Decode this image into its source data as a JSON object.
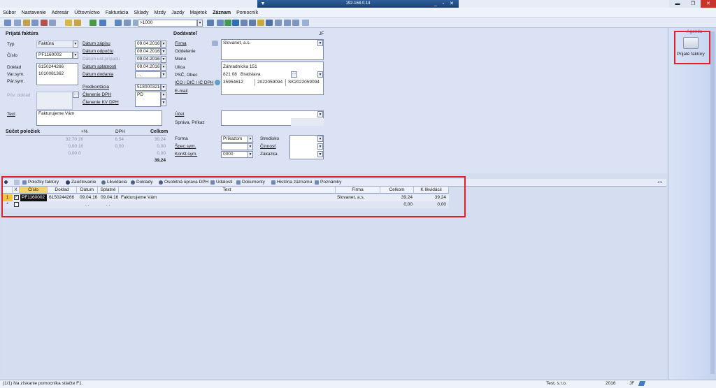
{
  "window": {
    "title_host": "192.168.0.14"
  },
  "menu": [
    "Súbor",
    "Nastavenie",
    "Adresár",
    "Účtovníctvo",
    "Fakturácia",
    "Sklady",
    "Mzdy",
    "Jazdy",
    "Majetok",
    "Záznam",
    "Pomocník"
  ],
  "toolbar": {
    "filter_value": ">1000"
  },
  "invoice": {
    "section_title": "Prijatá faktúra",
    "typ_label": "Typ",
    "typ_value": "Faktúra",
    "cislo_label": "Číslo",
    "cislo_value": "PF1160002",
    "doklad_label": "Doklad",
    "doklad_value": "6150244266",
    "varsym_label": "Var.sym.",
    "varsym_value": "1010081362",
    "parsym_label": "Pár.sym.",
    "povdoklad_label": "Pôv. doklad",
    "text_label": "Text",
    "text_value": "Fakturujeme Vám",
    "datum_zapisu_label": "Dátum zápisu",
    "datum_zapisu": "09.04.2016",
    "datum_odpoctu_label": "Dátum odpočtu",
    "datum_odpoctu": "09.04.2016",
    "datum_ust_label": "Dátum ust.prípadu",
    "datum_ust": "09.04.2016",
    "datum_splatnosti_label": "Dátum splatnosti",
    "datum_splatnosti": "09.04.2016",
    "datum_dodania_label": "Dátum dodania",
    "datum_dodania": ". .",
    "predkontacia_label": "Predkontácia",
    "predkontacia_value": "518000321000",
    "clenenie_dph_label": "Členenie DPH",
    "clenenie_dph_value": "PD",
    "clenenie_kv_label": "Členenie KV DPH"
  },
  "summary": {
    "title": "Súčet položiek",
    "col_pct": "+%",
    "col_dph": "DPH",
    "col_celkom": "Celkom",
    "rows": [
      {
        "base": "32,70",
        "pct": "20",
        "dph": "6,54",
        "total": "39,24"
      },
      {
        "base": "0,00",
        "pct": "10",
        "dph": "0,00",
        "total": "0,00"
      },
      {
        "base": "0,00",
        "pct": "0",
        "dph": "",
        "total": "0,00"
      }
    ],
    "grand_total": "39,24"
  },
  "supplier": {
    "section_title": "Dodávateľ",
    "initials": "JF",
    "firma_label": "Firma",
    "firma_value": "Slovanet, a.s.",
    "oddelenie_label": "Oddelenie",
    "meno_label": "Meno",
    "ulica_label": "Ulica",
    "ulica_value": "Záhradnícka 151",
    "psc_label": "PSČ, Obec",
    "psc_value": "821 08",
    "obec_value": "Bratislava",
    "ico_label": "IČO / DIČ / IČ DPH",
    "ico_value": "35954612",
    "dic_value": "2022059094",
    "icdph_value": "SK2022059094",
    "email_label": "E-mail",
    "ucet_label": "Účet",
    "sprava_label": "Správa, Príkaz",
    "forma_label": "Forma",
    "forma_value": "Príkazom",
    "specsym_label": "Špec.sym.",
    "konstsym_label": "Konšt.sym.",
    "konstsym_value": "0000",
    "stredisko_label": "Stredisko",
    "cinnost_label": "Činnosť",
    "zakazka_label": "Zákazka"
  },
  "tabs": [
    "Položky faktúry",
    "Zaúčtovanie",
    "Likvidácia",
    "Doklady",
    "Osobitná úprava DPH",
    "Udalosti",
    "Dokumenty",
    "História záznamu",
    "Poznámky"
  ],
  "grid": {
    "headers": [
      "X",
      "Číslo",
      "Doklad",
      "Dátum",
      "Splatné",
      "Text",
      "Firma",
      "Celkom",
      "K likvidácii"
    ],
    "rows": [
      {
        "n": "1",
        "cislo": "PF1160002",
        "doklad": "6150244266",
        "datum": "09.04.16",
        "splatne": "09.04.16",
        "text": "Fakturujeme Vám",
        "firma": "Slovanet, a.s.",
        "celkom": "39,24",
        "klikv": "39,24"
      },
      {
        "n": "*",
        "cislo": "",
        "doklad": "",
        "datum": ". .",
        "splatne": ". .",
        "text": "",
        "firma": "",
        "celkom": "0,00",
        "klikv": "0,00"
      }
    ]
  },
  "agenda": {
    "title": "Agenda",
    "item_label": "Prijaté faktúry"
  },
  "status": {
    "message": "(1/1) Na získanie pomocníka stlačte F1.",
    "company": "Test, s.r.o.",
    "year": "2016",
    "user": "JF"
  }
}
